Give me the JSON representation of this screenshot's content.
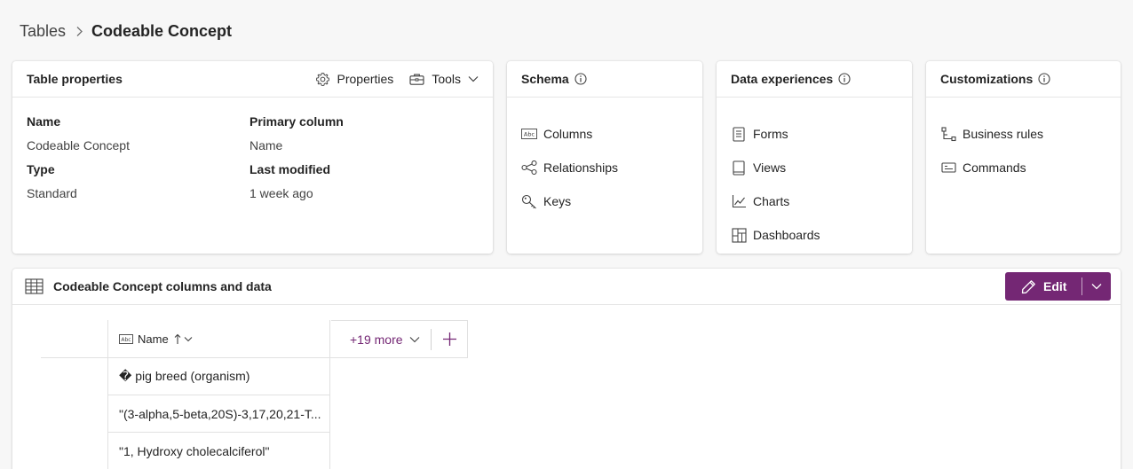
{
  "breadcrumb": {
    "parent": "Tables",
    "current": "Codeable Concept"
  },
  "table_properties": {
    "title": "Table properties",
    "properties_btn": "Properties",
    "tools_btn": "Tools",
    "fields": [
      {
        "label": "Name",
        "value": "Codeable Concept"
      },
      {
        "label": "Primary column",
        "value": "Name"
      },
      {
        "label": "Type",
        "value": "Standard"
      },
      {
        "label": "Last modified",
        "value": "1 week ago"
      }
    ]
  },
  "schema": {
    "title": "Schema",
    "items": [
      "Columns",
      "Relationships",
      "Keys"
    ]
  },
  "data_experiences": {
    "title": "Data experiences",
    "items": [
      "Forms",
      "Views",
      "Charts",
      "Dashboards"
    ]
  },
  "customizations": {
    "title": "Customizations",
    "items": [
      "Business rules",
      "Commands"
    ]
  },
  "data_section": {
    "title": "Codeable Concept columns and data",
    "edit_label": "Edit",
    "column_header": "Name",
    "more_label": "+19 more",
    "rows": [
      "� pig breed (organism)",
      "\"(3-alpha,5-beta,20S)-3,17,20,21-T...",
      "\"1, Hydroxy cholecalciferol\""
    ]
  },
  "colors": {
    "accent": "#742774"
  },
  "icons": {
    "properties": "gear-icon",
    "tools": "toolbox-icon",
    "info": "info-icon",
    "columns": "abc-icon",
    "relationships": "relationship-icon",
    "keys": "key-icon",
    "forms": "form-icon",
    "views": "view-icon",
    "charts": "chart-icon",
    "dashboards": "dashboard-icon",
    "business_rules": "business-rule-icon",
    "commands": "command-icon",
    "table": "table-icon",
    "edit": "pencil-icon",
    "add": "plus-icon"
  }
}
